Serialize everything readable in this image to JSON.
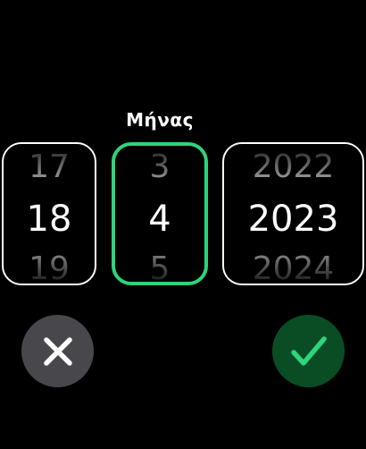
{
  "picker": {
    "title": "Μήνας",
    "day": {
      "prev": "17",
      "current": "18",
      "next": "19"
    },
    "month": {
      "prev": "3",
      "current": "4",
      "next": "5"
    },
    "year": {
      "prev": "2022",
      "current": "2023",
      "next": "2024"
    },
    "active_column": "month"
  },
  "actions": {
    "cancel_icon": "close-icon",
    "confirm_icon": "checkmark-icon"
  },
  "colors": {
    "accent": "#2ed57a",
    "confirm_bg": "#0a4d24",
    "cancel_bg": "#48484c",
    "background": "#000000",
    "dim_text": "#9a9a9a"
  }
}
